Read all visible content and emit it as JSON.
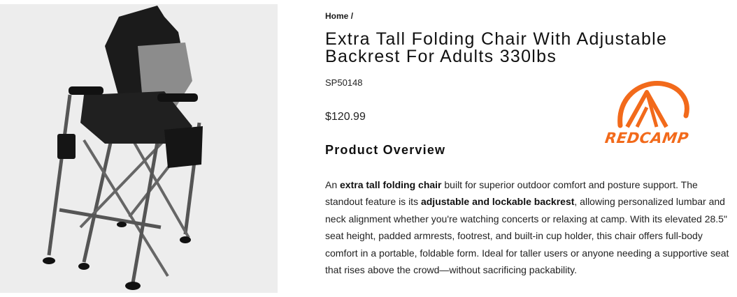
{
  "breadcrumb": {
    "home_label": "Home",
    "separator": "/"
  },
  "product": {
    "title_line1": "Extra Tall Folding Chair With Adjustable",
    "title_line2": "Backrest For Adults 330lbs",
    "sku": "SP50148",
    "price": "$120.99",
    "image_icon": "folding-chair-photo"
  },
  "brand": {
    "logo_text": "REDCAMP",
    "color": "#f26a1b"
  },
  "overview": {
    "heading": "Product Overview",
    "desc_1": "An ",
    "desc_b1": "extra tall folding chair",
    "desc_2": " built for superior outdoor comfort and posture support. The standout feature is its ",
    "desc_b2": "adjustable and lockable backrest",
    "desc_3": ", allowing personalized lumbar and neck alignment whether you're watching concerts or relaxing at camp. With its elevated 28.5\" seat height, padded armrests, footrest, and built-in cup holder, this chair offers full-body comfort in a portable, foldable form. Ideal for taller users or anyone needing a supportive seat that rises above the crowd—without sacrificing packability."
  }
}
